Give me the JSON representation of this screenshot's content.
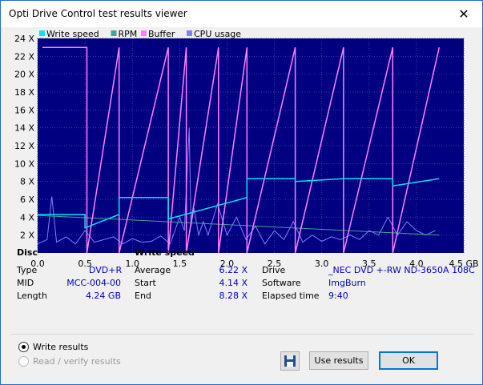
{
  "window": {
    "title": "Opti Drive Control test results viewer",
    "close_glyph": "✕"
  },
  "chart_data": {
    "type": "line",
    "legend": [
      "Write speed",
      "RPM",
      "Buffer",
      "CPU usage"
    ],
    "legend_colors": [
      "#00e5ee",
      "#3aa79a",
      "#ff80ff",
      "#8080ff"
    ],
    "y_ticks": [
      "2 X",
      "4 X",
      "6 X",
      "8 X",
      "10 X",
      "12 X",
      "14 X",
      "16 X",
      "18 X",
      "20 X",
      "22 X",
      "24 X"
    ],
    "x_ticks": [
      "0.0",
      "0.5",
      "1.0",
      "1.5",
      "2.0",
      "2.5",
      "3.0",
      "3.5",
      "4.0",
      "4.5 GB"
    ],
    "xlim": [
      0,
      4.5
    ],
    "ylim": [
      0,
      24
    ],
    "grid": true,
    "background": "#000080",
    "write_speed": {
      "x": [
        0,
        0.5,
        0.5,
        0.86,
        0.86,
        1.38,
        1.38,
        2.21,
        2.21,
        2.72,
        2.72,
        3.23,
        3.23,
        3.75,
        3.75,
        4.24
      ],
      "y": [
        4.3,
        4.3,
        2.8,
        4.3,
        6.2,
        6.2,
        3.8,
        6.2,
        8.3,
        8.3,
        8.0,
        8.3,
        8.3,
        8.3,
        7.5,
        8.3
      ]
    },
    "rpm": {
      "x": [
        0,
        4.24
      ],
      "y": [
        4.2,
        2.0
      ]
    },
    "buffer": {
      "x": [
        0.05,
        0.52,
        0.52,
        0.86,
        0.86,
        1.38,
        1.38,
        1.57,
        1.57,
        1.91,
        1.91,
        2.21,
        2.21,
        2.72,
        2.72,
        3.23,
        3.23,
        3.75,
        3.75,
        4.24
      ],
      "y": [
        23,
        23,
        0,
        23,
        0,
        23,
        0,
        23,
        0,
        23,
        0,
        23,
        0,
        23,
        0,
        23,
        0,
        23,
        0,
        23
      ]
    },
    "cpu_usage": {
      "x": [
        0,
        0.1,
        0.15,
        0.2,
        0.3,
        0.4,
        0.5,
        0.6,
        0.7,
        0.8,
        0.9,
        1.0,
        1.1,
        1.2,
        1.3,
        1.4,
        1.5,
        1.55,
        1.6,
        1.62,
        1.65,
        1.7,
        1.75,
        1.8,
        1.9,
        2.0,
        2.1,
        2.2,
        2.3,
        2.4,
        2.5,
        2.6,
        2.7,
        2.8,
        2.9,
        3.0,
        3.1,
        3.2,
        3.3,
        3.4,
        3.5,
        3.6,
        3.7,
        3.8,
        3.9,
        4.0,
        4.1,
        4.2
      ],
      "y": [
        1,
        1.5,
        6.3,
        1.2,
        1.8,
        1.0,
        2.5,
        1.2,
        1.5,
        1.8,
        1.0,
        1.6,
        1.2,
        1.3,
        1.9,
        1.0,
        4.0,
        2.5,
        14.0,
        3.0,
        5.0,
        2.0,
        3.5,
        2.0,
        5.5,
        2.0,
        4.0,
        1.5,
        3.0,
        1.0,
        2.5,
        1.5,
        3.5,
        1.2,
        2.0,
        1.3,
        1.8,
        1.5,
        2.0,
        1.5,
        2.5,
        2.0,
        4.0,
        2.0,
        3.5,
        2.5,
        2.0,
        2.5
      ]
    }
  },
  "disc": {
    "heading": "Disc",
    "rows": [
      {
        "label": "Type",
        "value": "DVD+R"
      },
      {
        "label": "MID",
        "value": "MCC-004-00"
      },
      {
        "label": "Length",
        "value": "4.24 GB"
      }
    ]
  },
  "write_speed": {
    "heading": "Write speed",
    "rows": [
      {
        "label": "Average",
        "value": "6.22 X"
      },
      {
        "label": "Start",
        "value": "4.14 X"
      },
      {
        "label": "End",
        "value": "8.28 X"
      }
    ]
  },
  "info": {
    "rows": [
      {
        "label": "Drive",
        "value": "_NEC DVD +-RW ND-3650A 108C"
      },
      {
        "label": "Software",
        "value": "ImgBurn"
      },
      {
        "label": "Elapsed time",
        "value": "9:40"
      }
    ]
  },
  "options": {
    "write_results": "Write results",
    "read_verify_results": "Read / verify results"
  },
  "buttons": {
    "use_results": "Use results",
    "ok": "OK"
  }
}
